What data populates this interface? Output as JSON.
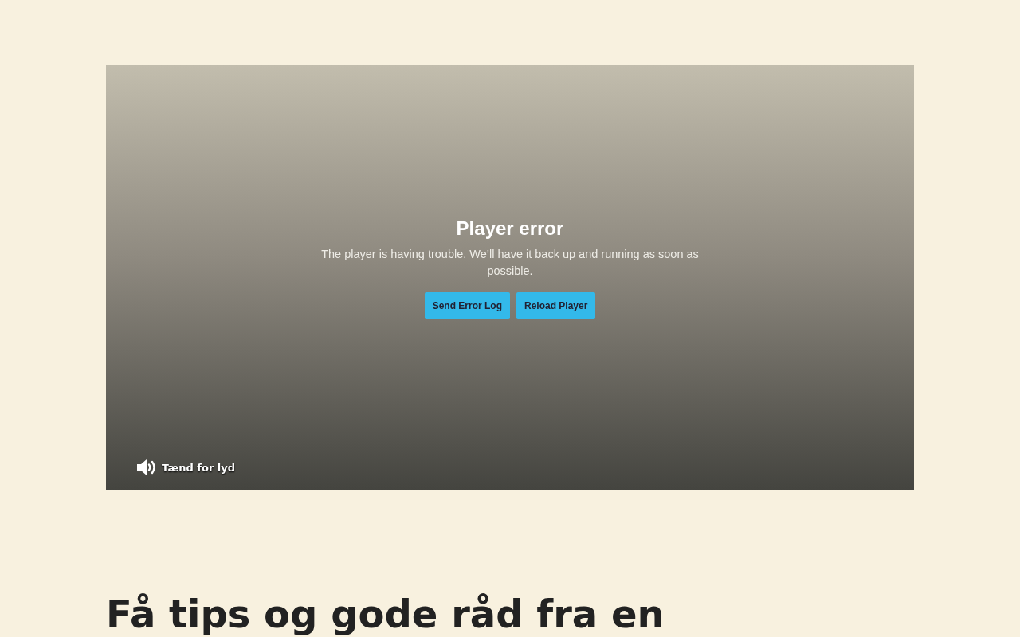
{
  "player": {
    "error_title": "Player error",
    "error_message": "The player is having trouble. We’ll have it back up and running as soon as possible.",
    "buttons": [
      "Send Error Log",
      "Reload Player"
    ],
    "sound_label": "Tænd for lyd",
    "muted": true
  },
  "heading": "Få tips og gode råd fra en"
}
